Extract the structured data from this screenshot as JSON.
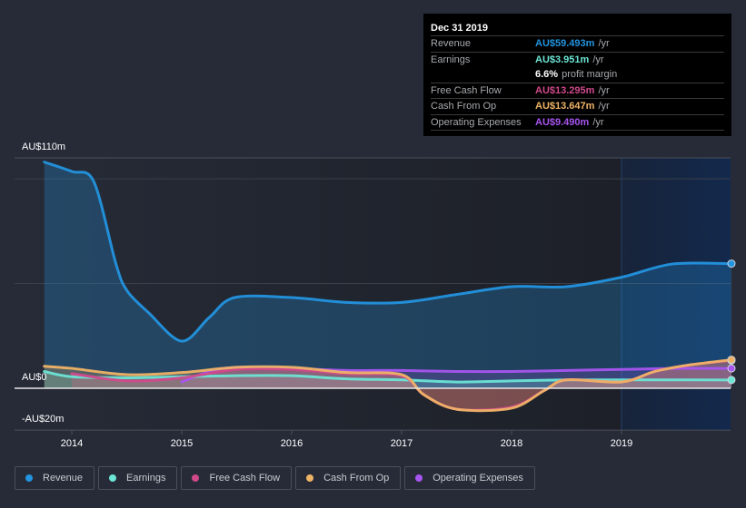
{
  "tooltip": {
    "date": "Dec 31 2019",
    "rows": [
      {
        "label": "Revenue",
        "value": "AU$59.493m",
        "unit": "/yr",
        "color": "#2394df"
      },
      {
        "label": "Earnings",
        "value": "AU$3.951m",
        "unit": "/yr",
        "color": "#6ce5d5"
      },
      {
        "label": "",
        "value": "6.6%",
        "unit": "profit margin",
        "color": "#ffffff"
      },
      {
        "label": "Free Cash Flow",
        "value": "AU$13.295m",
        "unit": "/yr",
        "color": "#d1498b"
      },
      {
        "label": "Cash From Op",
        "value": "AU$13.647m",
        "unit": "/yr",
        "color": "#efb366"
      },
      {
        "label": "Operating Expenses",
        "value": "AU$9.490m",
        "unit": "/yr",
        "color": "#a855f0"
      }
    ]
  },
  "legend": [
    {
      "label": "Revenue",
      "color": "#2394df"
    },
    {
      "label": "Earnings",
      "color": "#6ce5d5"
    },
    {
      "label": "Free Cash Flow",
      "color": "#d1498b"
    },
    {
      "label": "Cash From Op",
      "color": "#efb366"
    },
    {
      "label": "Operating Expenses",
      "color": "#a855f0"
    }
  ],
  "chart_data": {
    "type": "area",
    "title": "",
    "xlabel": "",
    "ylabel": "",
    "ylim": [
      -20,
      110
    ],
    "xlim": [
      2013.75,
      2020.0
    ],
    "y_tick_labels": [
      {
        "value": 110,
        "label": "AU$110m"
      },
      {
        "value": 0,
        "label": "AU$0"
      },
      {
        "value": -20,
        "label": "-AU$20m"
      }
    ],
    "gridlines": [
      100,
      50
    ],
    "x_ticks": [
      2014,
      2015,
      2016,
      2017,
      2018,
      2019
    ],
    "x_tick_labels": [
      "2014",
      "2015",
      "2016",
      "2017",
      "2018",
      "2019"
    ],
    "forecast_shade_start": 2019.0,
    "series": [
      {
        "name": "Revenue",
        "color": "#2394df",
        "x": [
          2013.75,
          2014.0,
          2014.2,
          2014.4,
          2014.5,
          2014.7,
          2015.0,
          2015.25,
          2015.48,
          2016.0,
          2016.5,
          2017.0,
          2017.48,
          2018.0,
          2018.5,
          2019.0,
          2019.46,
          2020.0
        ],
        "values": [
          108,
          103.5,
          98.7,
          59.7,
          46.8,
          36,
          22.5,
          33.8,
          43.3,
          43.3,
          41,
          41,
          44.6,
          48.5,
          48.5,
          53,
          59.3,
          59.5
        ]
      },
      {
        "name": "Earnings",
        "color": "#6ce5d5",
        "x": [
          2013.75,
          2014.0,
          2014.5,
          2015.0,
          2015.5,
          2016.0,
          2016.5,
          2017.0,
          2017.5,
          2018.0,
          2018.5,
          2019.0,
          2019.5,
          2020.0
        ],
        "values": [
          8,
          5.5,
          5,
          5.5,
          6,
          6,
          4.5,
          4,
          3,
          3.5,
          4,
          4,
          4,
          3.95
        ]
      },
      {
        "name": "Free Cash Flow",
        "color": "#d1498b",
        "x": [
          2014.0,
          2014.5,
          2015.0,
          2015.5,
          2016.0,
          2016.5,
          2017.0,
          2017.2,
          2017.5,
          2018.0,
          2018.3,
          2018.5,
          2019.0,
          2019.3,
          2019.6,
          2020.0
        ],
        "values": [
          7,
          3.5,
          5,
          9,
          9,
          7,
          6,
          -3,
          -10,
          -9,
          -1,
          4,
          3,
          8,
          11,
          13.3
        ]
      },
      {
        "name": "Cash From Op",
        "color": "#efb366",
        "x": [
          2013.75,
          2014.0,
          2014.5,
          2015.0,
          2015.5,
          2016.0,
          2016.5,
          2017.0,
          2017.2,
          2017.5,
          2018.0,
          2018.3,
          2018.5,
          2019.0,
          2019.3,
          2019.6,
          2020.0
        ],
        "values": [
          10.5,
          9.5,
          6.5,
          7.5,
          10,
          10,
          7.5,
          6.5,
          -3,
          -10,
          -9.5,
          -1,
          4,
          3,
          8,
          11,
          13.6
        ]
      },
      {
        "name": "Operating Expenses",
        "color": "#a855f0",
        "x": [
          2015.0,
          2015.25,
          2015.5,
          2016.0,
          2016.5,
          2017.0,
          2017.5,
          2018.0,
          2018.5,
          2019.0,
          2019.5,
          2020.0
        ],
        "values": [
          3,
          8,
          10,
          9.5,
          8.5,
          8.5,
          8,
          8,
          8.5,
          9,
          9.5,
          9.5
        ]
      }
    ]
  }
}
